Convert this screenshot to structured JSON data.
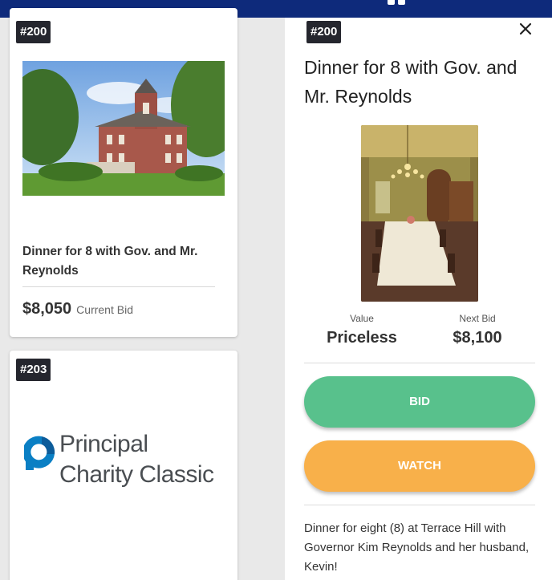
{
  "colors": {
    "topbar": "#0e2a7b",
    "badge": "#25262e",
    "bid_button": "#58c18c",
    "watch_button": "#f8b04a"
  },
  "items": [
    {
      "lot": "#200",
      "title": "Dinner for 8 with Gov. and Mr. Reynolds",
      "current_bid": "$8,050",
      "current_bid_label": "Current Bid",
      "image": "mansion-photo"
    },
    {
      "lot": "#203",
      "logo_line1": "Principal",
      "logo_line2": "Charity Classic",
      "image": "principal-charity-classic-logo"
    }
  ],
  "detail": {
    "lot": "#200",
    "title": "Dinner for 8 with Gov. and Mr. Reynolds",
    "close_icon": "close-icon",
    "image": "dining-room-photo",
    "value_label": "Value",
    "value": "Priceless",
    "next_bid_label": "Next Bid",
    "next_bid": "$8,100",
    "bid_label": "BID",
    "watch_label": "WATCH",
    "description": "Dinner for eight (8) at Terrace Hill with Governor Kim Reynolds and her husband, Kevin!"
  }
}
